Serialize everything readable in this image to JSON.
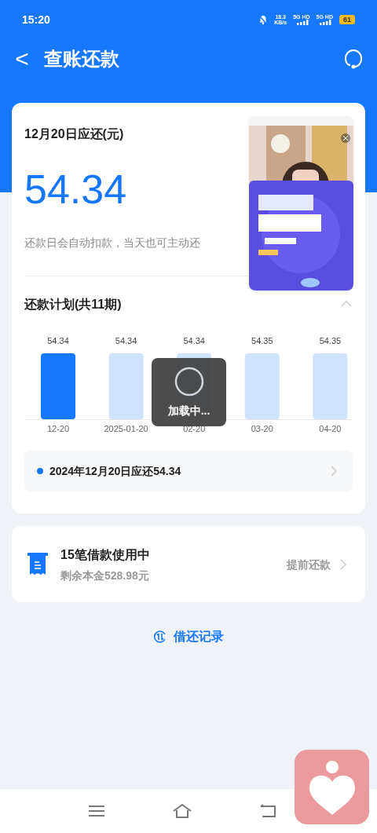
{
  "status_bar": {
    "time": "15:20",
    "net_speed": "18.3",
    "net_unit": "KB/s",
    "sim_1": "5G HD",
    "sim_2": "5G HD",
    "battery": "61"
  },
  "header": {
    "back": "<",
    "title": "查账还款"
  },
  "due": {
    "label": "12月20日应还(元)",
    "amount": "54.34",
    "note": "还款日会自动扣款，当天也可主动还"
  },
  "plan": {
    "title": "还款计划(共11期)",
    "expanded": true,
    "chart_data": {
      "type": "bar",
      "categories": [
        "12-20",
        "2025-01-20",
        "02-20",
        "03-20",
        "04-20"
      ],
      "values": [
        54.34,
        54.34,
        54.34,
        54.35,
        54.35
      ],
      "data_labels": true
    },
    "periods": [
      {
        "selected": true
      },
      {
        "selected": false
      },
      {
        "selected": false
      },
      {
        "selected": false
      },
      {
        "selected": false
      }
    ],
    "summary": {
      "text": "2024年12月20日应还54.34",
      "color": "#1677ff"
    }
  },
  "loading": {
    "text": "加载中..."
  },
  "loans": {
    "title": "15笔借款使用中",
    "subtitle": "剩余本金528.98元",
    "action": "提前还款"
  },
  "records_link": "借还记录"
}
